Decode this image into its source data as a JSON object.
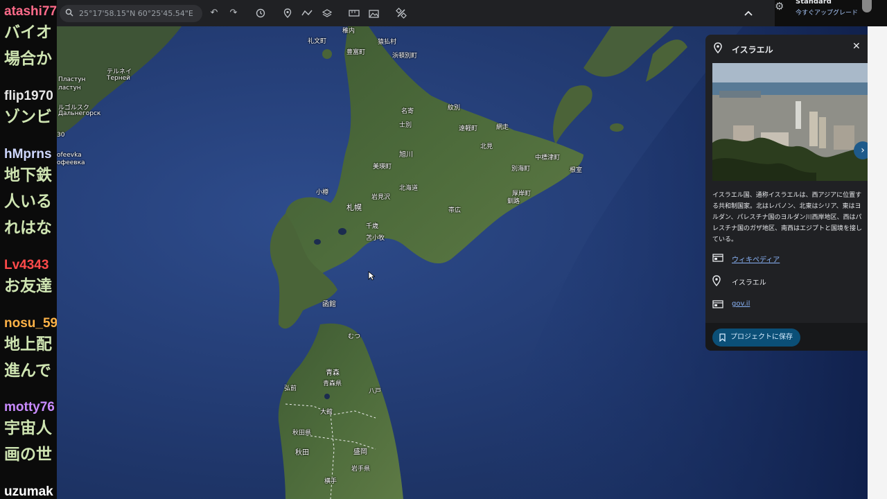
{
  "chat": {
    "messages": [
      {
        "user": "atashi77",
        "user_color": "#ff6b8a",
        "lines": [
          "バイオ",
          "場合か"
        ]
      },
      {
        "user": "flip1970",
        "user_color": "#e8e8e8",
        "lines": [
          "ゾンビ"
        ]
      },
      {
        "user": "hMprns",
        "user_color": "#cfd8ff",
        "lines": [
          "地下鉄",
          "人いる",
          "れはな"
        ]
      },
      {
        "user": "Lv4343",
        "user_color": "#ff4a4a",
        "lines": [
          "お友達"
        ]
      },
      {
        "user": "nosu_59",
        "user_color": "#ffb347",
        "lines": [
          "地上配",
          "進んで"
        ]
      },
      {
        "user": "motty76",
        "user_color": "#c98bff",
        "lines": [
          "宇宙人",
          "画の世"
        ]
      },
      {
        "user": "uzumak",
        "user_color": "#ffffff",
        "lines": []
      }
    ]
  },
  "toolbar": {
    "search_value": "25°17'58.15\"N 60°25'45.54\"E",
    "tools": [
      "undo-icon",
      "redo-icon",
      "history-icon",
      "pin-icon",
      "path-icon",
      "layers-icon",
      "ruler-icon",
      "image-icon",
      "satellite-icon"
    ],
    "collapse_icon": "chevron-up-icon"
  },
  "account": {
    "plan": "Standard",
    "upgrade": "今すぐアップグレード"
  },
  "map": {
    "labels": [
      "稚内",
      "礼文町",
      "猿払村",
      "豊富町",
      "浜頓別町",
      "名寄",
      "紋別",
      "士別",
      "遠軽町",
      "網走",
      "旭川",
      "北見",
      "中標津町",
      "美瑛町",
      "別海町",
      "根室",
      "北海道",
      "小樽",
      "札幌",
      "岩見沢",
      "帯広",
      "厚岸町",
      "釧路",
      "千歳",
      "苫小牧",
      "函館",
      "むつ",
      "青森",
      "青森県",
      "弘前",
      "八戸",
      "大館",
      "秋田県",
      "秋田",
      "盛岡",
      "岩手県",
      "横手",
      "テルネイ",
      "Терней",
      "Пластун",
      "ластун",
      "Дальнегорск",
      "ルゴルスク",
      "ofeevka",
      "офеевка",
      "30"
    ]
  },
  "panel": {
    "title": "イスラエル",
    "description": "イスラエル国、通称イスラエルは、西アジアに位置する共和制国家。北はレバノン、北東はシリア、東はヨルダン、パレスチナ国のヨルダン川西岸地区、西はパレスチナ国のガザ地区、南西はエジプトと国境を接している。",
    "rows": [
      {
        "icon": "web-icon",
        "text": "ウィキペディア",
        "link": true
      },
      {
        "icon": "place-icon",
        "text": "イスラエル",
        "link": false
      },
      {
        "icon": "web-icon",
        "text": "gov.il",
        "link": true
      }
    ],
    "save_label": "プロジェクトに保存"
  }
}
